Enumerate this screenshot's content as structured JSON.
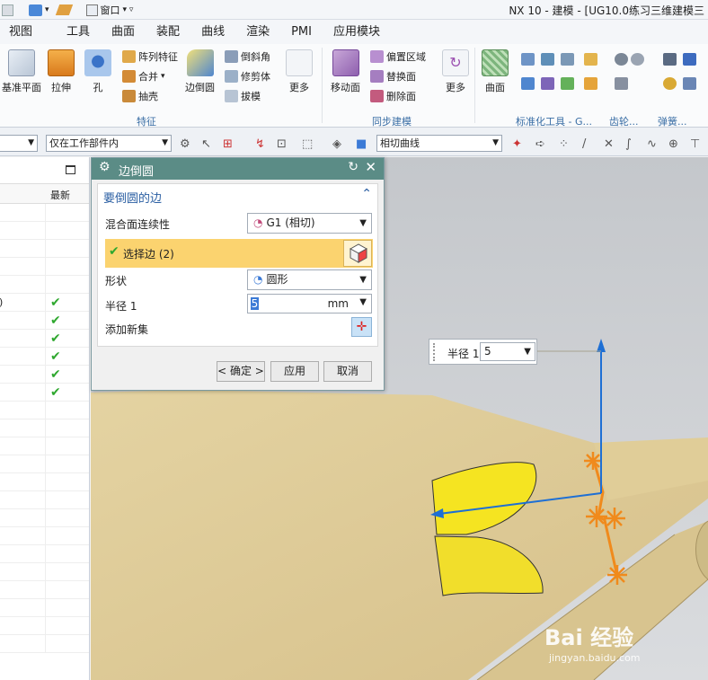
{
  "window": {
    "title": "NX 10 - 建模 - [UG10.0练习三维建模三"
  },
  "quick_access": {
    "window_menu": "窗口"
  },
  "menu": [
    "视图",
    "工具",
    "曲面",
    "装配",
    "曲线",
    "渲染",
    "PMI",
    "应用模块"
  ],
  "ribbon": {
    "feature_group": {
      "label": "特征",
      "large": [
        "基准平面",
        "拉伸",
        "孔",
        "边倒圆",
        "更多"
      ],
      "small": [
        "阵列特征",
        "合并",
        "抽壳",
        "倒斜角",
        "修剪体",
        "拔模"
      ]
    },
    "sync_group": {
      "label": "同步建模",
      "large": [
        "移动面",
        "更多"
      ],
      "small": [
        "偏置区域",
        "替换面",
        "删除面"
      ]
    },
    "surface_group": {
      "large": [
        "曲面"
      ]
    },
    "std_tools_label": "标准化工具 - G...",
    "gear_label": "齿轮...",
    "spring_label": "弹簧..."
  },
  "toolbar": {
    "filter_value": "仅在工作部件内",
    "curve_rule": "相切曲线"
  },
  "nav_panel": {
    "column_latest": "最新",
    "row_fragment": ")"
  },
  "dialog": {
    "title": "边倒圆",
    "section": "要倒圆的边",
    "blend_label": "混合面连续性",
    "blend_value": "G1 (相切)",
    "select_edge": "选择边 (2)",
    "shape_label": "形状",
    "shape_value": "圆形",
    "radius_label": "半径 1",
    "radius_value": "5",
    "radius_unit": "mm",
    "add_set_label": "添加新集",
    "ok": "< 确定 >",
    "apply": "应用",
    "cancel": "取消"
  },
  "floating": {
    "label": "半径 1",
    "value": "5"
  },
  "watermark": {
    "brand": "Bai 经验",
    "url": "jingyan.baidu.com"
  },
  "colors": {
    "dialog_title": "#5b8c86",
    "select_highlight": "#fbd36f",
    "part_tan": "#e2cf9a",
    "face_yellow": "#f5e421",
    "handle_blue": "#1e6fd4",
    "handle_orange": "#f08a1c"
  }
}
